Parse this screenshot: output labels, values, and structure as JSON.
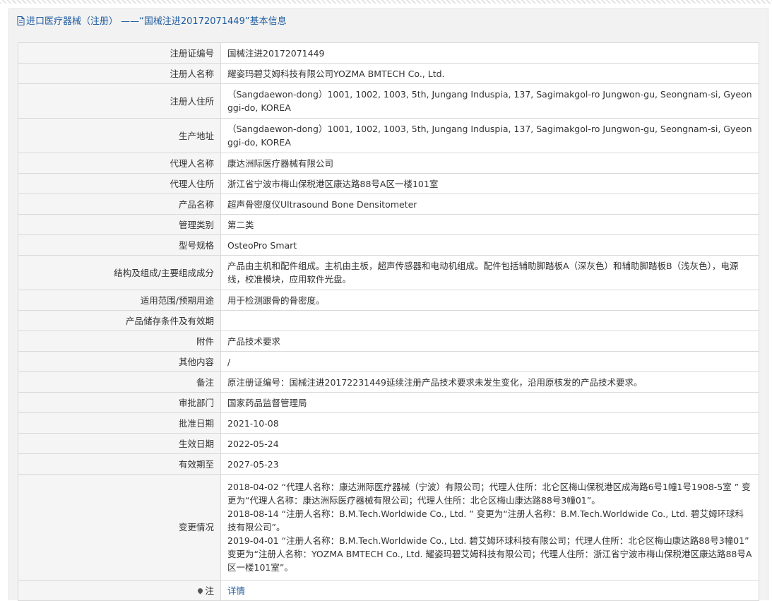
{
  "header": {
    "title": "进口医疗器械（注册） ——“国械注进20172071449”基本信息"
  },
  "rows": [
    {
      "label": "注册证编号",
      "value": "国械注进20172071449"
    },
    {
      "label": "注册人名称",
      "value": "耀姿玛碧艾姆科技有限公司YOZMA BMTECH Co., Ltd."
    },
    {
      "label": "注册人住所",
      "value": "（Sangdaewon-dong）1001, 1002, 1003, 5th, Jungang Induspia, 137, Sagimakgol-ro Jungwon-gu, Seongnam-si, Gyeonggi-do, KOREA"
    },
    {
      "label": "生产地址",
      "value": "（Sangdaewon-dong）1001, 1002, 1003, 5th, Jungang Induspia, 137, Sagimakgol-ro Jungwon-gu, Seongnam-si, Gyeonggi-do, KOREA"
    },
    {
      "label": "代理人名称",
      "value": "康达洲际医疗器械有限公司"
    },
    {
      "label": "代理人住所",
      "value": "浙江省宁波市梅山保税港区康达路88号A区一楼101室"
    },
    {
      "label": "产品名称",
      "value": "超声骨密度仪Ultrasound Bone Densitometer"
    },
    {
      "label": "管理类别",
      "value": "第二类"
    },
    {
      "label": "型号规格",
      "value": "OsteoPro Smart"
    },
    {
      "label": "结构及组成/主要组成成分",
      "value": "产品由主机和配件组成。主机由主板，超声传感器和电动机组成。配件包括辅助脚踏板A（深灰色）和辅助脚踏板B（浅灰色），电源线，校准模块，应用软件光盘。"
    },
    {
      "label": "适用范围/预期用途",
      "value": "用于检测跟骨的骨密度。"
    },
    {
      "label": "产品储存条件及有效期",
      "value": ""
    },
    {
      "label": "附件",
      "value": "产品技术要求"
    },
    {
      "label": "其他内容",
      "value": "/"
    },
    {
      "label": "备注",
      "value": "原注册证编号：国械注进20172231449延续注册产品技术要求未发生变化，沿用原核发的产品技术要求。"
    },
    {
      "label": "审批部门",
      "value": "国家药品监督管理局"
    },
    {
      "label": "批准日期",
      "value": "2021-10-08"
    },
    {
      "label": "生效日期",
      "value": "2022-05-24"
    },
    {
      "label": "有效期至",
      "value": "2027-05-23"
    }
  ],
  "changes": {
    "label": "变更情况",
    "entries": [
      "2018-04-02 “代理人名称：康达洲际医疗器械（宁波）有限公司；代理人住所：北仑区梅山保税港区成海路6号1幢1号1908-5室 ” 变更为“代理人名称：康达洲际医疗器械有限公司；代理人住所：北仑区梅山康达路88号3幢01”。",
      "2018-08-14 “注册人名称：B.M.Tech.Worldwide Co., Ltd. ” 变更为“注册人名称：B.M.Tech.Worldwide Co., Ltd. 碧艾姆环球科技有限公司”。",
      "2019-04-01 “注册人名称：B.M.Tech.Worldwide Co., Ltd. 碧艾姆环球科技有限公司；代理人住所：北仑区梅山康达路88号3幢01” 变更为“注册人名称：YOZMA BMTECH Co., Ltd. 耀姿玛碧艾姆科技有限公司；代理人住所：浙江省宁波市梅山保税港区康达路88号A区一楼101室”。"
    ]
  },
  "note": {
    "label": "注",
    "link_text": "详情"
  },
  "colors": {
    "accent": "#1d5b9e",
    "label_bg": "#f5f5f5",
    "border": "#d9d9d9"
  }
}
